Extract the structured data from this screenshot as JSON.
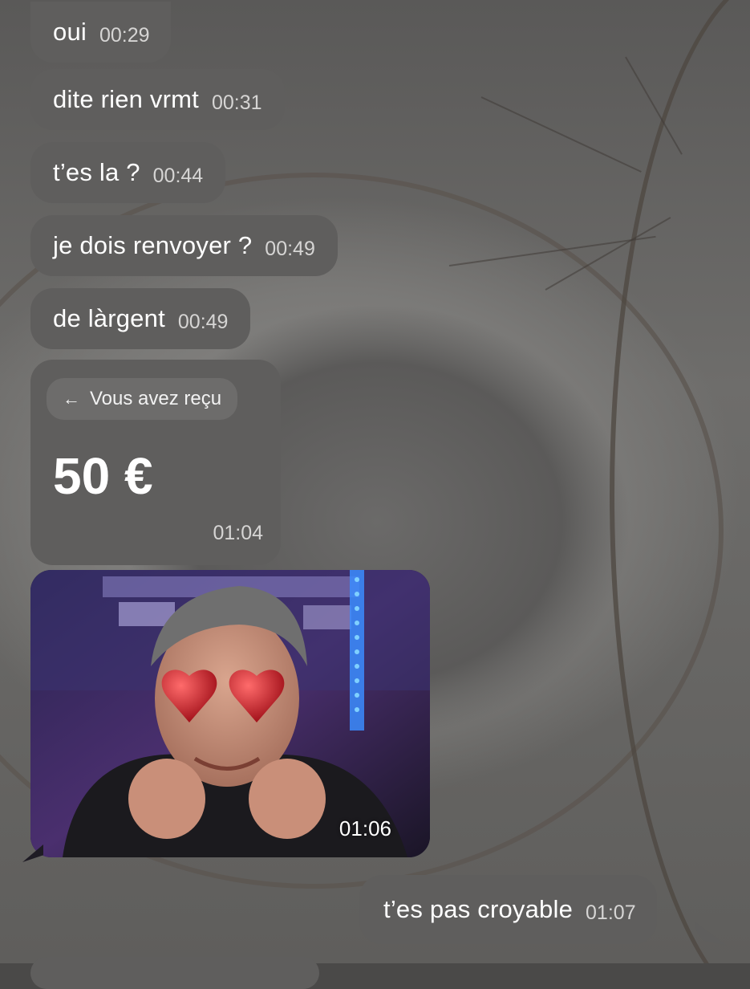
{
  "messages": [
    {
      "text": "oui",
      "time": "00:29"
    },
    {
      "text": "dite rien vrmt",
      "time": "00:31"
    },
    {
      "text": "t’es la ?",
      "time": "00:44"
    },
    {
      "text": "je dois renvoyer ?",
      "time": "00:49"
    },
    {
      "text": "de làrgent",
      "time": "00:49"
    }
  ],
  "payment": {
    "label": "Vous avez reçu",
    "amount": "50 €",
    "time": "01:04"
  },
  "gif": {
    "time": "01:06"
  },
  "sent": {
    "text": "t’es pas croyable",
    "time": "01:07"
  },
  "colors": {
    "bubble": "#5f5e5d",
    "chip": "#6d6c6b",
    "heart": "#c8242b"
  },
  "icons": [
    "arrow-left-icon",
    "heart-eyes-icon"
  ]
}
